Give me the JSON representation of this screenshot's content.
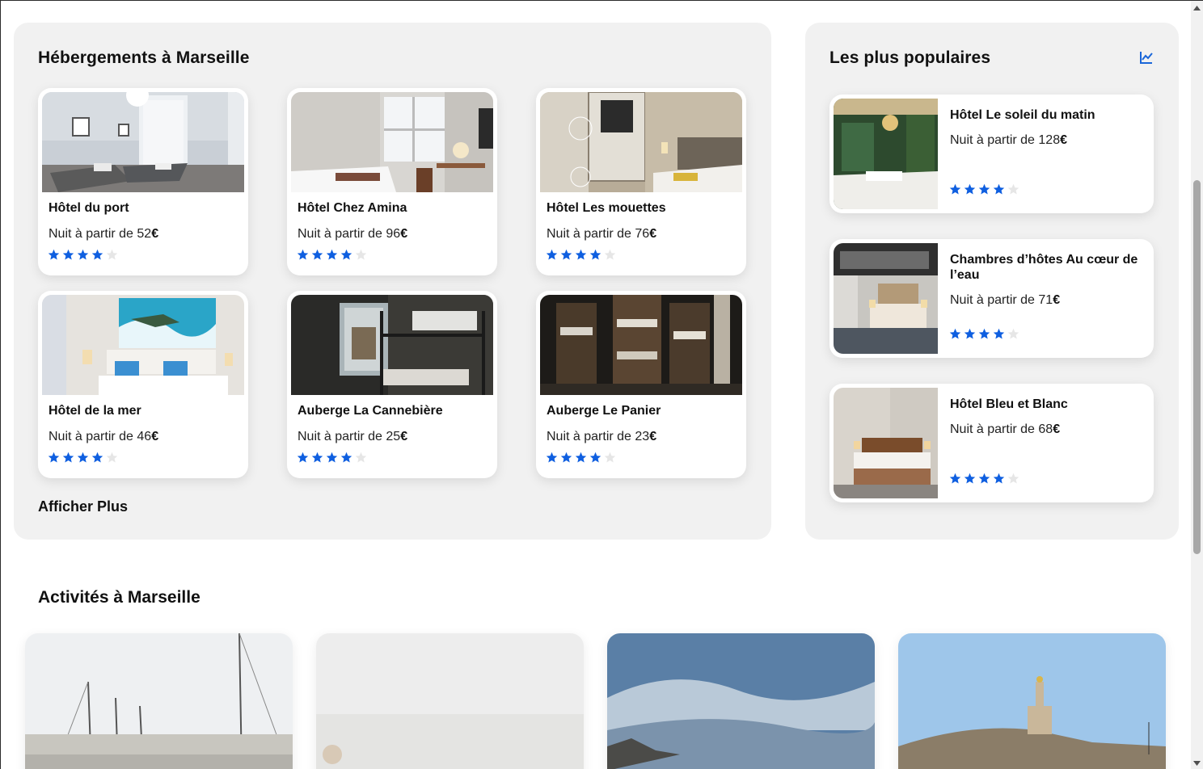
{
  "hebergements": {
    "title": "Hébergements à Marseille",
    "price_prefix": "Nuit à partir de",
    "currency": "€",
    "more_label": "Afficher Plus",
    "cards": [
      {
        "name": "Hôtel du port",
        "price": "52",
        "rating": 4
      },
      {
        "name": "Hôtel Chez Amina",
        "price": "96",
        "rating": 4
      },
      {
        "name": "Hôtel Les mouettes",
        "price": "76",
        "rating": 4
      },
      {
        "name": "Hôtel de la mer",
        "price": "46",
        "rating": 4
      },
      {
        "name": "Auberge La Cannebière",
        "price": "25",
        "rating": 4
      },
      {
        "name": "Auberge Le Panier",
        "price": "23",
        "rating": 4
      }
    ]
  },
  "populaires": {
    "title": "Les plus populaires",
    "icon": "trending-chart-icon",
    "price_prefix": "Nuit à partir de",
    "currency": "€",
    "cards": [
      {
        "name": "Hôtel Le soleil du matin",
        "price": "128",
        "rating": 4
      },
      {
        "name": "Chambres d’hôtes Au cœur de l’eau",
        "price": "71",
        "rating": 4
      },
      {
        "name": "Hôtel Bleu et Blanc",
        "price": "68",
        "rating": 4
      }
    ]
  },
  "activites": {
    "title": "Activités à Marseille"
  },
  "colors": {
    "star_filled": "#0f5fe0",
    "star_empty": "#e6e6e6",
    "accent": "#1a66d9",
    "panel_bg": "#f1f1f1"
  }
}
